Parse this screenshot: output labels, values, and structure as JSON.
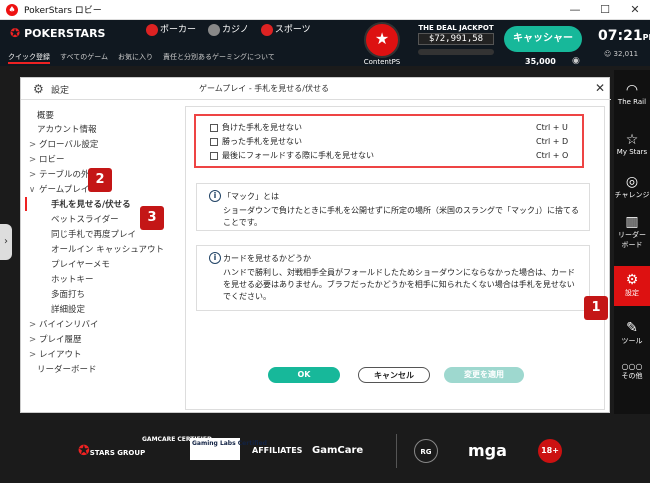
{
  "window": {
    "title": "PokerStars ロビー",
    "minimize": "—",
    "maximize": "☐",
    "close": "✕"
  },
  "header": {
    "logo": "POKERSTARS",
    "topnav": [
      "ポーカー",
      "カジノ",
      "スポーツ"
    ],
    "subnav": [
      "クイック登録",
      "すべてのゲーム",
      "お気に入り",
      "責任と分別あるゲーミングについて"
    ],
    "contentps": "ContentPS",
    "jackpot_title": "THE DEAL JACKPOT",
    "jackpot_value": "$72,991,58",
    "cashier": "キャッシャー",
    "balance": "35,000",
    "time": "07:21",
    "ampm": "PM",
    "users": "32,011"
  },
  "panel": {
    "title": "設定",
    "breadcrumb": "ゲームプレイ - 手札を見せる/伏せる",
    "close": "✕"
  },
  "leftnav": [
    {
      "label": "概要",
      "chev": ""
    },
    {
      "label": "アカウント情報",
      "chev": ""
    },
    {
      "label": "グローバル設定",
      "chev": ">"
    },
    {
      "label": "ロビー",
      "chev": ">"
    },
    {
      "label": "テーブルの外",
      "chev": ">"
    },
    {
      "label": "ゲームプレイ",
      "chev": "∨"
    },
    {
      "label": "手札を見せる/伏せる",
      "chev": "",
      "sub": true,
      "sel": true
    },
    {
      "label": "ベットスライダー",
      "chev": "",
      "sub": true
    },
    {
      "label": "同じ手札で再度プレイ",
      "chev": "",
      "sub": true
    },
    {
      "label": "オールイン キャッシュアウト",
      "chev": "",
      "sub": true
    },
    {
      "label": "プレイヤーメモ",
      "chev": "",
      "sub": true
    },
    {
      "label": "ホットキー",
      "chev": "",
      "sub": true
    },
    {
      "label": "多面打ち",
      "chev": "",
      "sub": true
    },
    {
      "label": "詳細設定",
      "chev": "",
      "sub": true
    },
    {
      "label": "バイインリバイ",
      "chev": ">"
    },
    {
      "label": "プレイ履歴",
      "chev": ">"
    },
    {
      "label": "レイアウト",
      "chev": ">"
    },
    {
      "label": "リーダーボード",
      "chev": ""
    }
  ],
  "hands": [
    {
      "label": "負けた手札を見せない",
      "shortcut": "Ctrl + U"
    },
    {
      "label": "勝った手札を見せない",
      "shortcut": "Ctrl + D"
    },
    {
      "label": "最後にフォールドする際に手札を見せない",
      "shortcut": "Ctrl + O"
    }
  ],
  "info1": {
    "title": "「マック」とは",
    "body": "ショーダウンで負けたときに手札を公開せずに所定の場所（米国のスラングで「マック」）に捨てることです。"
  },
  "info2": {
    "title": "カードを見せるかどうか",
    "body": "ハンドで勝利し、対戦相手全員がフォールドしたためショーダウンにならなかった場合は、カードを見せる必要はありません。ブラフだったかどうかを相手に知られたくない場合は手札を見せないでください。"
  },
  "buttons": {
    "ok": "OK",
    "cancel": "キャンセル",
    "apply": "変更を適用"
  },
  "markers": [
    "1",
    "2",
    "3"
  ],
  "rail": [
    {
      "label": "The Rail",
      "icon": "◠"
    },
    {
      "label": "My Stars",
      "icon": "☆"
    },
    {
      "label": "チャレンジ",
      "icon": "◎"
    },
    {
      "label": "リーダー\nボード",
      "icon": "▥"
    },
    {
      "label": "設定",
      "icon": "⚙"
    },
    {
      "label": "ツール",
      "icon": "✎"
    },
    {
      "label": "その他",
      "icon": "○○○"
    }
  ],
  "footer": {
    "stars_group": "STARS GROUP",
    "gamcare_certified": "GAMCARE CERTIFIED",
    "gaming_labs": "Gaming Labs Certified",
    "affiliates": "AFFILIATES",
    "gamcare": "GamCare",
    "rg": "RG",
    "mga": "mga",
    "age": "18+"
  },
  "colors": {
    "accent": "#17b89a",
    "red": "#e11d1d",
    "dark": "#101820"
  }
}
